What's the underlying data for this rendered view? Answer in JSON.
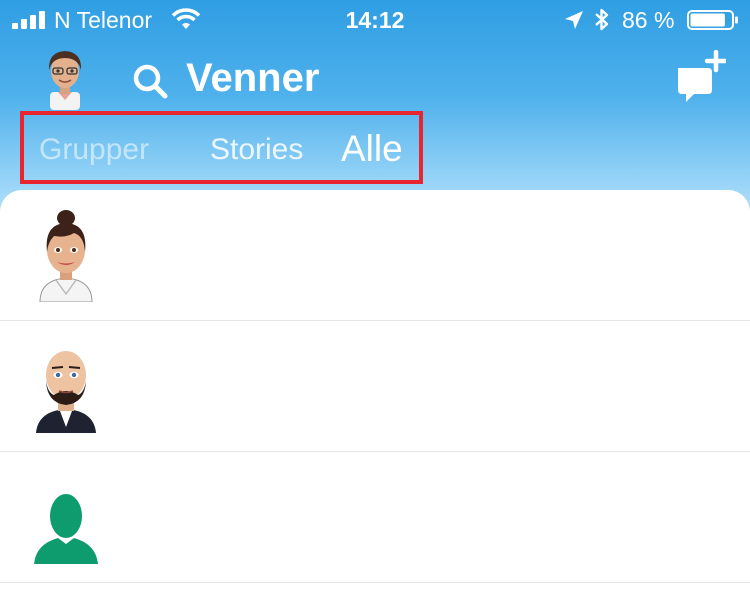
{
  "status_bar": {
    "carrier": "N Telenor",
    "time": "14:12",
    "battery": "86 %",
    "battery_level": 0.86
  },
  "header": {
    "title": "Venner"
  },
  "tabs": [
    {
      "label": "Grupper",
      "active": false
    },
    {
      "label": "Stories",
      "active": false
    },
    {
      "label": "Alle",
      "active": true
    }
  ],
  "friends": [
    {
      "avatar": "bitmoji-woman-avatar"
    },
    {
      "avatar": "bitmoji-bald-man-avatar"
    },
    {
      "avatar": "default-silhouette-avatar"
    }
  ],
  "colors": {
    "header_top": "#2f9ee3",
    "header_bottom": "#b3e0fb",
    "highlight_box": "#e9252f",
    "default_avatar": "#0e9b6e"
  }
}
